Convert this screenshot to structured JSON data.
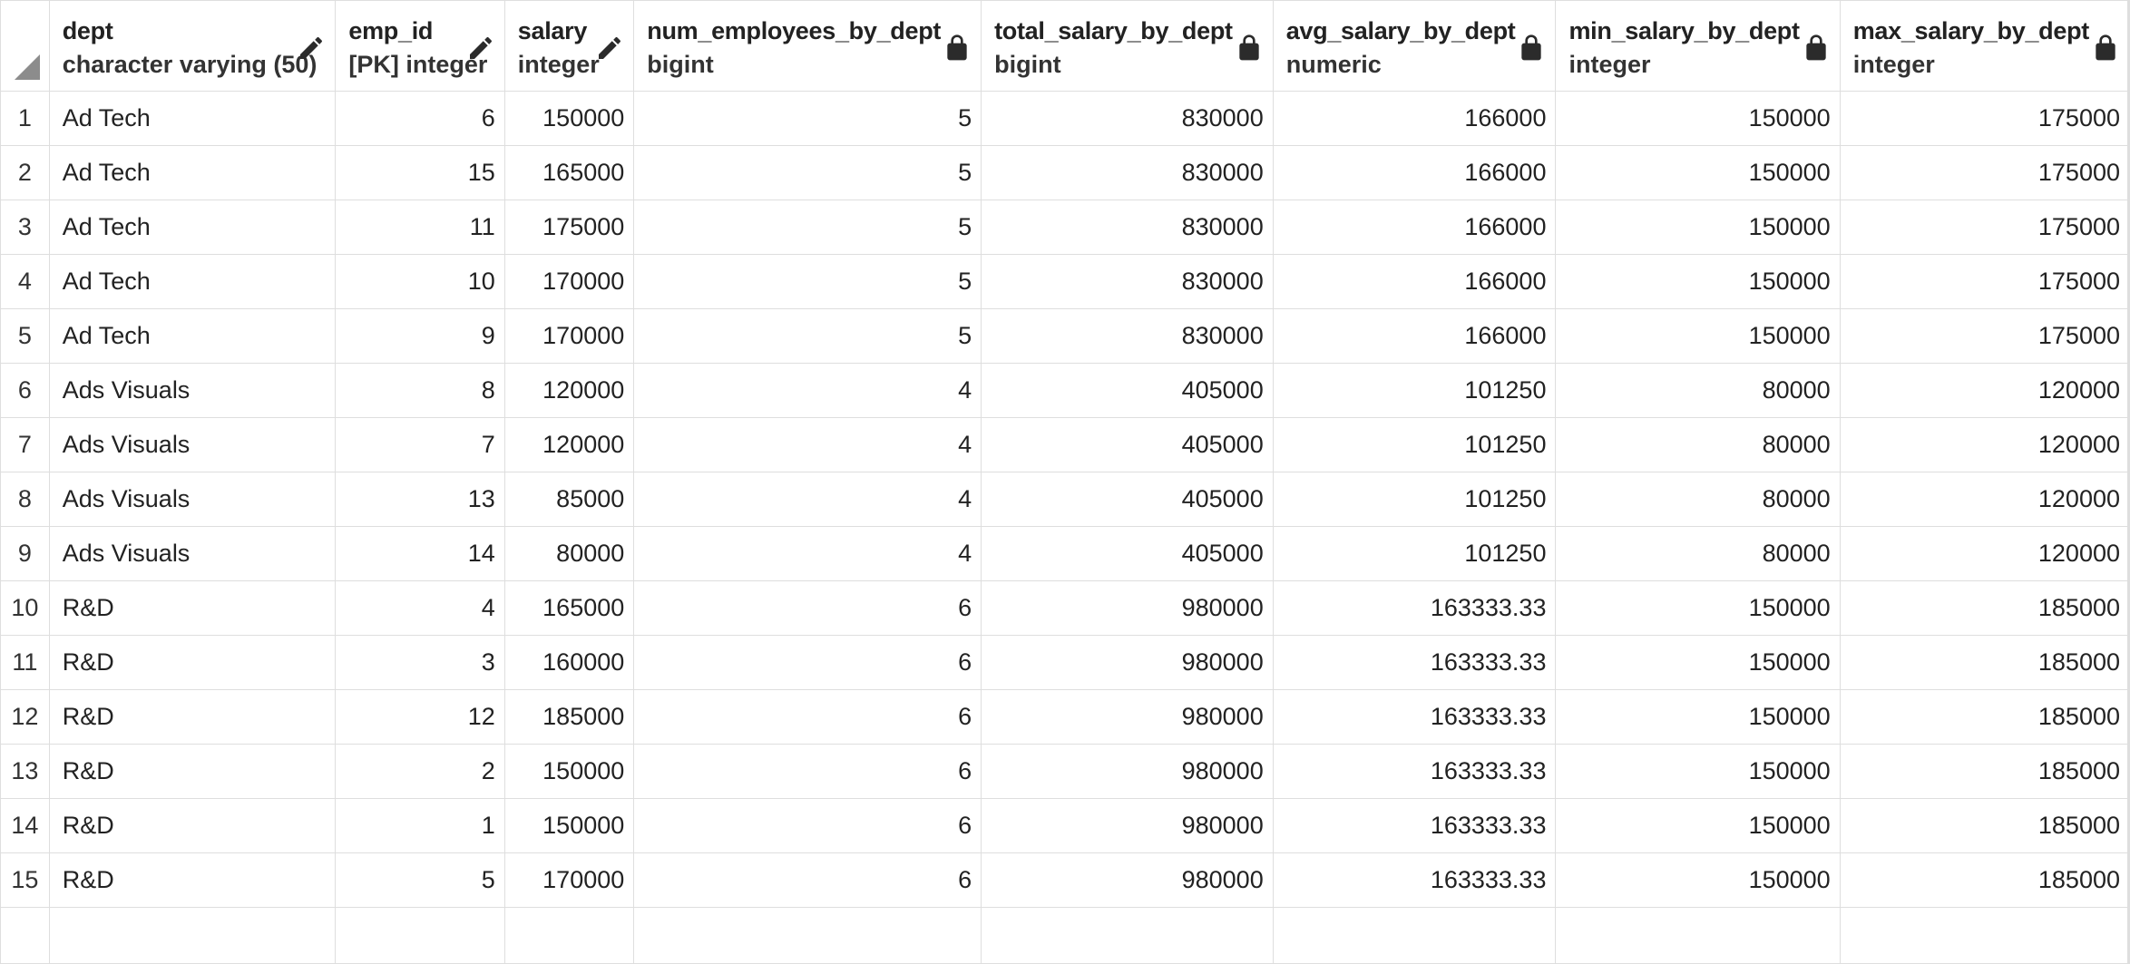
{
  "columns": [
    {
      "name": "dept",
      "type": "character varying (50)",
      "icon": "pencil-icon"
    },
    {
      "name": "emp_id",
      "type": "[PK] integer",
      "icon": "pencil-icon"
    },
    {
      "name": "salary",
      "type": "integer",
      "icon": "pencil-icon"
    },
    {
      "name": "num_employees_by_dept",
      "type": "bigint",
      "icon": "lock-icon"
    },
    {
      "name": "total_salary_by_dept",
      "type": "bigint",
      "icon": "lock-icon"
    },
    {
      "name": "avg_salary_by_dept",
      "type": "numeric",
      "icon": "lock-icon"
    },
    {
      "name": "min_salary_by_dept",
      "type": "integer",
      "icon": "lock-icon"
    },
    {
      "name": "max_salary_by_dept",
      "type": "integer",
      "icon": "lock-icon"
    }
  ],
  "rows": [
    [
      "1",
      "Ad Tech",
      "6",
      "150000",
      "5",
      "830000",
      "166000",
      "150000",
      "175000"
    ],
    [
      "2",
      "Ad Tech",
      "15",
      "165000",
      "5",
      "830000",
      "166000",
      "150000",
      "175000"
    ],
    [
      "3",
      "Ad Tech",
      "11",
      "175000",
      "5",
      "830000",
      "166000",
      "150000",
      "175000"
    ],
    [
      "4",
      "Ad Tech",
      "10",
      "170000",
      "5",
      "830000",
      "166000",
      "150000",
      "175000"
    ],
    [
      "5",
      "Ad Tech",
      "9",
      "170000",
      "5",
      "830000",
      "166000",
      "150000",
      "175000"
    ],
    [
      "6",
      "Ads Visuals",
      "8",
      "120000",
      "4",
      "405000",
      "101250",
      "80000",
      "120000"
    ],
    [
      "7",
      "Ads Visuals",
      "7",
      "120000",
      "4",
      "405000",
      "101250",
      "80000",
      "120000"
    ],
    [
      "8",
      "Ads Visuals",
      "13",
      "85000",
      "4",
      "405000",
      "101250",
      "80000",
      "120000"
    ],
    [
      "9",
      "Ads Visuals",
      "14",
      "80000",
      "4",
      "405000",
      "101250",
      "80000",
      "120000"
    ],
    [
      "10",
      "R&D",
      "4",
      "165000",
      "6",
      "980000",
      "163333.33",
      "150000",
      "185000"
    ],
    [
      "11",
      "R&D",
      "3",
      "160000",
      "6",
      "980000",
      "163333.33",
      "150000",
      "185000"
    ],
    [
      "12",
      "R&D",
      "12",
      "185000",
      "6",
      "980000",
      "163333.33",
      "150000",
      "185000"
    ],
    [
      "13",
      "R&D",
      "2",
      "150000",
      "6",
      "980000",
      "163333.33",
      "150000",
      "185000"
    ],
    [
      "14",
      "R&D",
      "1",
      "150000",
      "6",
      "980000",
      "163333.33",
      "150000",
      "185000"
    ],
    [
      "15",
      "R&D",
      "5",
      "170000",
      "6",
      "980000",
      "163333.33",
      "150000",
      "185000"
    ]
  ]
}
